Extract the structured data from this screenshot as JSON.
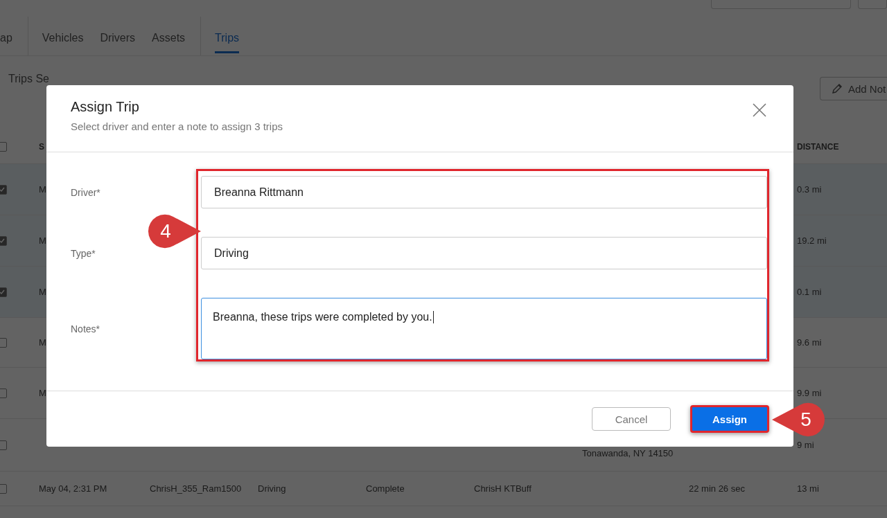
{
  "tabs": [
    {
      "label": "ap",
      "selected": false
    },
    {
      "label": "Vehicles",
      "selected": false
    },
    {
      "label": "Drivers",
      "selected": false
    },
    {
      "label": "Assets",
      "selected": false
    },
    {
      "label": "Trips",
      "selected": true
    }
  ],
  "selection_bar": {
    "text": "Trips Se",
    "add_note": "Add Not"
  },
  "table": {
    "all_selected": false,
    "columns": {
      "column_1": "S",
      "distance": "DISTANCE"
    },
    "rows": [
      {
        "selected": true,
        "column_1": "M",
        "distance": "0.3 mi"
      },
      {
        "selected": true,
        "column_1": "M",
        "distance": "19.2 mi"
      },
      {
        "selected": true,
        "column_1": "M",
        "distance": "0.1 mi"
      },
      {
        "selected": false,
        "column_1": "M",
        "distance": "9.6 mi"
      },
      {
        "selected": false,
        "column_1": "M",
        "distance": "9.9 mi"
      },
      {
        "selected": false,
        "column_6": "Tonawanda, NY 14150",
        "distance": "9 mi"
      },
      {
        "selected": false,
        "column_1": "May 04, 2:31 PM",
        "column_2": "ChrisH_355_Ram1500",
        "column_3": "Driving",
        "column_4": "Complete",
        "column_5": "ChrisH KTBuff",
        "column_7": "22 min 26 sec",
        "distance": "13 mi"
      }
    ]
  },
  "dialog": {
    "title": "Assign Trip",
    "subtitle": "Select driver and enter a note to assign 3 trips",
    "fields": [
      {
        "label": "Driver*",
        "kind": "input",
        "value": "Breanna Rittmann",
        "focused": false
      },
      {
        "label": "Type*",
        "kind": "input",
        "value": "Driving",
        "focused": false
      },
      {
        "label": "Notes*",
        "kind": "textarea",
        "value": "Breanna, these trips were completed by you.",
        "focused": true
      }
    ],
    "buttons": [
      {
        "label": "Cancel",
        "kind": "secondary"
      },
      {
        "label": "Assign",
        "kind": "primary"
      }
    ]
  },
  "callouts": [
    {
      "number": "4"
    },
    {
      "number": "5"
    }
  ]
}
